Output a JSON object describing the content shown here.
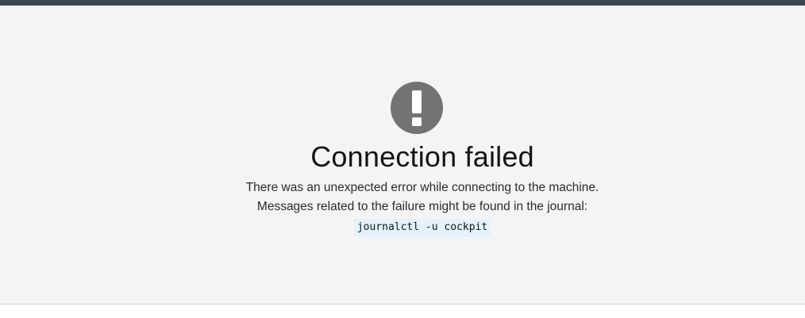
{
  "error": {
    "title": "Connection failed",
    "line1": "There was an unexpected error while connecting to the machine.",
    "line2": "Messages related to the failure might be found in the journal:",
    "command": "journalctl -u cockpit",
    "icon": "exclamation-circle-icon"
  },
  "colors": {
    "topbar": "#3c4650",
    "background": "#f4f4f4",
    "icon": "#737373",
    "code_background": "#e3f2fb"
  }
}
